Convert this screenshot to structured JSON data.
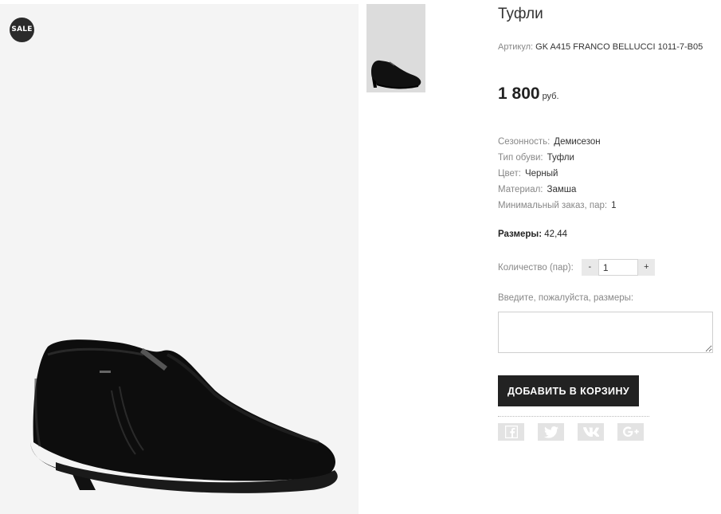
{
  "product": {
    "sale_badge": "SALE",
    "title": "Туфли",
    "sku_label": "Артикул:",
    "sku_value": "GK A415 FRANCO BELLUCCI 1011-7-B05",
    "price_value": "1 800",
    "price_currency": "руб."
  },
  "properties": [
    {
      "label": "Сезонность:",
      "value": "Демисезон"
    },
    {
      "label": "Тип обуви:",
      "value": "Туфли"
    },
    {
      "label": "Цвет:",
      "value": "Черный"
    },
    {
      "label": "Материал:",
      "value": "Замша"
    },
    {
      "label": "Минимальный заказ, пар:",
      "value": "1"
    }
  ],
  "sizes": {
    "label": "Размеры:",
    "value": "42,44"
  },
  "quantity": {
    "label": "Количество (пар):",
    "minus": "-",
    "value": "1",
    "plus": "+"
  },
  "size_input": {
    "prompt": "Введите, пожалуйста, размеры:",
    "value": ""
  },
  "cart": {
    "add_label": "ДОБАВИТЬ В КОРЗИНУ"
  },
  "social": [
    {
      "icon": "facebook-icon"
    },
    {
      "icon": "twitter-icon"
    },
    {
      "icon": "vk-icon"
    },
    {
      "icon": "google-plus-icon"
    }
  ],
  "colors": {
    "button_bg": "#222222",
    "badge_bg": "#2b2b2b",
    "muted_text": "#888888",
    "social_bg": "#e3e3e3",
    "social_icon": "#ffffff"
  }
}
